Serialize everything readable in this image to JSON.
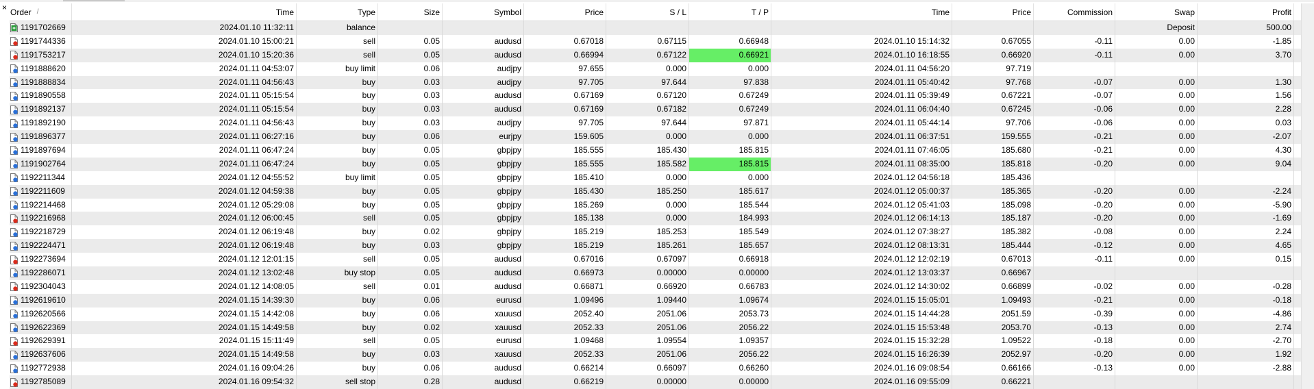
{
  "close_label": "×",
  "columns": {
    "order": "Order",
    "sort_indicator": "/",
    "time": "Time",
    "type": "Type",
    "size": "Size",
    "symbol": "Symbol",
    "price": "Price",
    "sl": "S / L",
    "tp": "T / P",
    "close_time": "Time",
    "close_price": "Price",
    "commission": "Commission",
    "swap": "Swap",
    "profit": "Profit"
  },
  "colors": {
    "highlight": "#66ee66",
    "row_alt": "#ebebeb",
    "buy_icon": "#2a6fd6",
    "sell_icon": "#d92b1c",
    "balance_icon": "#2a9a3a"
  },
  "rows": [
    {
      "order": "1191702669",
      "time": "2024.01.10 11:32:11",
      "type": "balance",
      "size": "",
      "symbol": "",
      "price": "",
      "sl": "",
      "tp": "",
      "close_time": "",
      "close_price": "",
      "commission": "",
      "swap": "Deposit",
      "profit": "500.00",
      "icon": "balance",
      "tp_hl": false
    },
    {
      "order": "1191744336",
      "time": "2024.01.10 15:00:21",
      "type": "sell",
      "size": "0.05",
      "symbol": "audusd",
      "price": "0.67018",
      "sl": "0.67115",
      "tp": "0.66948",
      "close_time": "2024.01.10 15:14:32",
      "close_price": "0.67055",
      "commission": "-0.11",
      "swap": "0.00",
      "profit": "-1.85",
      "icon": "sell",
      "tp_hl": false
    },
    {
      "order": "1191753217",
      "time": "2024.01.10 15:20:36",
      "type": "sell",
      "size": "0.05",
      "symbol": "audusd",
      "price": "0.66994",
      "sl": "0.67122",
      "tp": "0.66921",
      "close_time": "2024.01.10 16:18:55",
      "close_price": "0.66920",
      "commission": "-0.11",
      "swap": "0.00",
      "profit": "3.70",
      "icon": "sell",
      "tp_hl": true
    },
    {
      "order": "1191888620",
      "time": "2024.01.11 04:53:07",
      "type": "buy limit",
      "size": "0.06",
      "symbol": "audjpy",
      "price": "97.655",
      "sl": "0.000",
      "tp": "0.000",
      "close_time": "2024.01.11 04:56:20",
      "close_price": "97.719",
      "commission": "",
      "swap": "",
      "profit": "",
      "icon": "buy",
      "tp_hl": false
    },
    {
      "order": "1191888834",
      "time": "2024.01.11 04:56:43",
      "type": "buy",
      "size": "0.03",
      "symbol": "audjpy",
      "price": "97.705",
      "sl": "97.644",
      "tp": "97.838",
      "close_time": "2024.01.11 05:40:42",
      "close_price": "97.768",
      "commission": "-0.07",
      "swap": "0.00",
      "profit": "1.30",
      "icon": "buy",
      "tp_hl": false
    },
    {
      "order": "1191890558",
      "time": "2024.01.11 05:15:54",
      "type": "buy",
      "size": "0.03",
      "symbol": "audusd",
      "price": "0.67169",
      "sl": "0.67120",
      "tp": "0.67249",
      "close_time": "2024.01.11 05:39:49",
      "close_price": "0.67221",
      "commission": "-0.07",
      "swap": "0.00",
      "profit": "1.56",
      "icon": "buy",
      "tp_hl": false
    },
    {
      "order": "1191892137",
      "time": "2024.01.11 05:15:54",
      "type": "buy",
      "size": "0.03",
      "symbol": "audusd",
      "price": "0.67169",
      "sl": "0.67182",
      "tp": "0.67249",
      "close_time": "2024.01.11 06:04:40",
      "close_price": "0.67245",
      "commission": "-0.06",
      "swap": "0.00",
      "profit": "2.28",
      "icon": "buy",
      "tp_hl": false
    },
    {
      "order": "1191892190",
      "time": "2024.01.11 04:56:43",
      "type": "buy",
      "size": "0.03",
      "symbol": "audjpy",
      "price": "97.705",
      "sl": "97.644",
      "tp": "97.871",
      "close_time": "2024.01.11 05:44:14",
      "close_price": "97.706",
      "commission": "-0.06",
      "swap": "0.00",
      "profit": "0.03",
      "icon": "buy",
      "tp_hl": false
    },
    {
      "order": "1191896377",
      "time": "2024.01.11 06:27:16",
      "type": "buy",
      "size": "0.06",
      "symbol": "eurjpy",
      "price": "159.605",
      "sl": "0.000",
      "tp": "0.000",
      "close_time": "2024.01.11 06:37:51",
      "close_price": "159.555",
      "commission": "-0.21",
      "swap": "0.00",
      "profit": "-2.07",
      "icon": "buy",
      "tp_hl": false
    },
    {
      "order": "1191897694",
      "time": "2024.01.11 06:47:24",
      "type": "buy",
      "size": "0.05",
      "symbol": "gbpjpy",
      "price": "185.555",
      "sl": "185.430",
      "tp": "185.815",
      "close_time": "2024.01.11 07:46:05",
      "close_price": "185.680",
      "commission": "-0.21",
      "swap": "0.00",
      "profit": "4.30",
      "icon": "buy",
      "tp_hl": false
    },
    {
      "order": "1191902764",
      "time": "2024.01.11 06:47:24",
      "type": "buy",
      "size": "0.05",
      "symbol": "gbpjpy",
      "price": "185.555",
      "sl": "185.582",
      "tp": "185.815",
      "close_time": "2024.01.11 08:35:00",
      "close_price": "185.818",
      "commission": "-0.20",
      "swap": "0.00",
      "profit": "9.04",
      "icon": "buy",
      "tp_hl": true
    },
    {
      "order": "1192211344",
      "time": "2024.01.12 04:55:52",
      "type": "buy limit",
      "size": "0.05",
      "symbol": "gbpjpy",
      "price": "185.410",
      "sl": "0.000",
      "tp": "0.000",
      "close_time": "2024.01.12 04:56:18",
      "close_price": "185.436",
      "commission": "",
      "swap": "",
      "profit": "",
      "icon": "buy",
      "tp_hl": false
    },
    {
      "order": "1192211609",
      "time": "2024.01.12 04:59:38",
      "type": "buy",
      "size": "0.05",
      "symbol": "gbpjpy",
      "price": "185.430",
      "sl": "185.250",
      "tp": "185.617",
      "close_time": "2024.01.12 05:00:37",
      "close_price": "185.365",
      "commission": "-0.20",
      "swap": "0.00",
      "profit": "-2.24",
      "icon": "buy",
      "tp_hl": false
    },
    {
      "order": "1192214468",
      "time": "2024.01.12 05:29:08",
      "type": "buy",
      "size": "0.05",
      "symbol": "gbpjpy",
      "price": "185.269",
      "sl": "0.000",
      "tp": "185.544",
      "close_time": "2024.01.12 05:41:03",
      "close_price": "185.098",
      "commission": "-0.20",
      "swap": "0.00",
      "profit": "-5.90",
      "icon": "buy",
      "tp_hl": false
    },
    {
      "order": "1192216968",
      "time": "2024.01.12 06:00:45",
      "type": "sell",
      "size": "0.05",
      "symbol": "gbpjpy",
      "price": "185.138",
      "sl": "0.000",
      "tp": "184.993",
      "close_time": "2024.01.12 06:14:13",
      "close_price": "185.187",
      "commission": "-0.20",
      "swap": "0.00",
      "profit": "-1.69",
      "icon": "sell",
      "tp_hl": false
    },
    {
      "order": "1192218729",
      "time": "2024.01.12 06:19:48",
      "type": "buy",
      "size": "0.02",
      "symbol": "gbpjpy",
      "price": "185.219",
      "sl": "185.253",
      "tp": "185.549",
      "close_time": "2024.01.12 07:38:27",
      "close_price": "185.382",
      "commission": "-0.08",
      "swap": "0.00",
      "profit": "2.24",
      "icon": "buy",
      "tp_hl": false
    },
    {
      "order": "1192224471",
      "time": "2024.01.12 06:19:48",
      "type": "buy",
      "size": "0.03",
      "symbol": "gbpjpy",
      "price": "185.219",
      "sl": "185.261",
      "tp": "185.657",
      "close_time": "2024.01.12 08:13:31",
      "close_price": "185.444",
      "commission": "-0.12",
      "swap": "0.00",
      "profit": "4.65",
      "icon": "buy",
      "tp_hl": false
    },
    {
      "order": "1192273694",
      "time": "2024.01.12 12:01:15",
      "type": "sell",
      "size": "0.05",
      "symbol": "audusd",
      "price": "0.67016",
      "sl": "0.67097",
      "tp": "0.66918",
      "close_time": "2024.01.12 12:02:19",
      "close_price": "0.67013",
      "commission": "-0.11",
      "swap": "0.00",
      "profit": "0.15",
      "icon": "sell",
      "tp_hl": false
    },
    {
      "order": "1192286071",
      "time": "2024.01.12 13:02:48",
      "type": "buy stop",
      "size": "0.05",
      "symbol": "audusd",
      "price": "0.66973",
      "sl": "0.00000",
      "tp": "0.00000",
      "close_time": "2024.01.12 13:03:37",
      "close_price": "0.66967",
      "commission": "",
      "swap": "",
      "profit": "",
      "icon": "buy",
      "tp_hl": false
    },
    {
      "order": "1192304043",
      "time": "2024.01.12 14:08:05",
      "type": "sell",
      "size": "0.01",
      "symbol": "audusd",
      "price": "0.66871",
      "sl": "0.66920",
      "tp": "0.66783",
      "close_time": "2024.01.12 14:30:02",
      "close_price": "0.66899",
      "commission": "-0.02",
      "swap": "0.00",
      "profit": "-0.28",
      "icon": "sell",
      "tp_hl": false
    },
    {
      "order": "1192619610",
      "time": "2024.01.15 14:39:30",
      "type": "buy",
      "size": "0.06",
      "symbol": "eurusd",
      "price": "1.09496",
      "sl": "1.09440",
      "tp": "1.09674",
      "close_time": "2024.01.15 15:05:01",
      "close_price": "1.09493",
      "commission": "-0.21",
      "swap": "0.00",
      "profit": "-0.18",
      "icon": "buy",
      "tp_hl": false
    },
    {
      "order": "1192620566",
      "time": "2024.01.15 14:42:08",
      "type": "buy",
      "size": "0.06",
      "symbol": "xauusd",
      "price": "2052.40",
      "sl": "2051.06",
      "tp": "2053.73",
      "close_time": "2024.01.15 14:44:28",
      "close_price": "2051.59",
      "commission": "-0.39",
      "swap": "0.00",
      "profit": "-4.86",
      "icon": "buy",
      "tp_hl": false
    },
    {
      "order": "1192622369",
      "time": "2024.01.15 14:49:58",
      "type": "buy",
      "size": "0.02",
      "symbol": "xauusd",
      "price": "2052.33",
      "sl": "2051.06",
      "tp": "2056.22",
      "close_time": "2024.01.15 15:53:48",
      "close_price": "2053.70",
      "commission": "-0.13",
      "swap": "0.00",
      "profit": "2.74",
      "icon": "buy",
      "tp_hl": false
    },
    {
      "order": "1192629391",
      "time": "2024.01.15 15:11:49",
      "type": "sell",
      "size": "0.05",
      "symbol": "eurusd",
      "price": "1.09468",
      "sl": "1.09554",
      "tp": "1.09357",
      "close_time": "2024.01.15 15:32:28",
      "close_price": "1.09522",
      "commission": "-0.18",
      "swap": "0.00",
      "profit": "-2.70",
      "icon": "sell",
      "tp_hl": false
    },
    {
      "order": "1192637606",
      "time": "2024.01.15 14:49:58",
      "type": "buy",
      "size": "0.03",
      "symbol": "xauusd",
      "price": "2052.33",
      "sl": "2051.06",
      "tp": "2056.22",
      "close_time": "2024.01.15 16:26:39",
      "close_price": "2052.97",
      "commission": "-0.20",
      "swap": "0.00",
      "profit": "1.92",
      "icon": "buy",
      "tp_hl": false
    },
    {
      "order": "1192772938",
      "time": "2024.01.16 09:04:26",
      "type": "buy",
      "size": "0.06",
      "symbol": "audusd",
      "price": "0.66214",
      "sl": "0.66097",
      "tp": "0.66260",
      "close_time": "2024.01.16 09:08:54",
      "close_price": "0.66166",
      "commission": "-0.13",
      "swap": "0.00",
      "profit": "-2.88",
      "icon": "buy",
      "tp_hl": false
    },
    {
      "order": "1192785089",
      "time": "2024.01.16 09:54:32",
      "type": "sell stop",
      "size": "0.28",
      "symbol": "audusd",
      "price": "0.66219",
      "sl": "0.00000",
      "tp": "0.00000",
      "close_time": "2024.01.16 09:55:09",
      "close_price": "0.66221",
      "commission": "",
      "swap": "",
      "profit": "",
      "icon": "sell",
      "tp_hl": false
    }
  ]
}
